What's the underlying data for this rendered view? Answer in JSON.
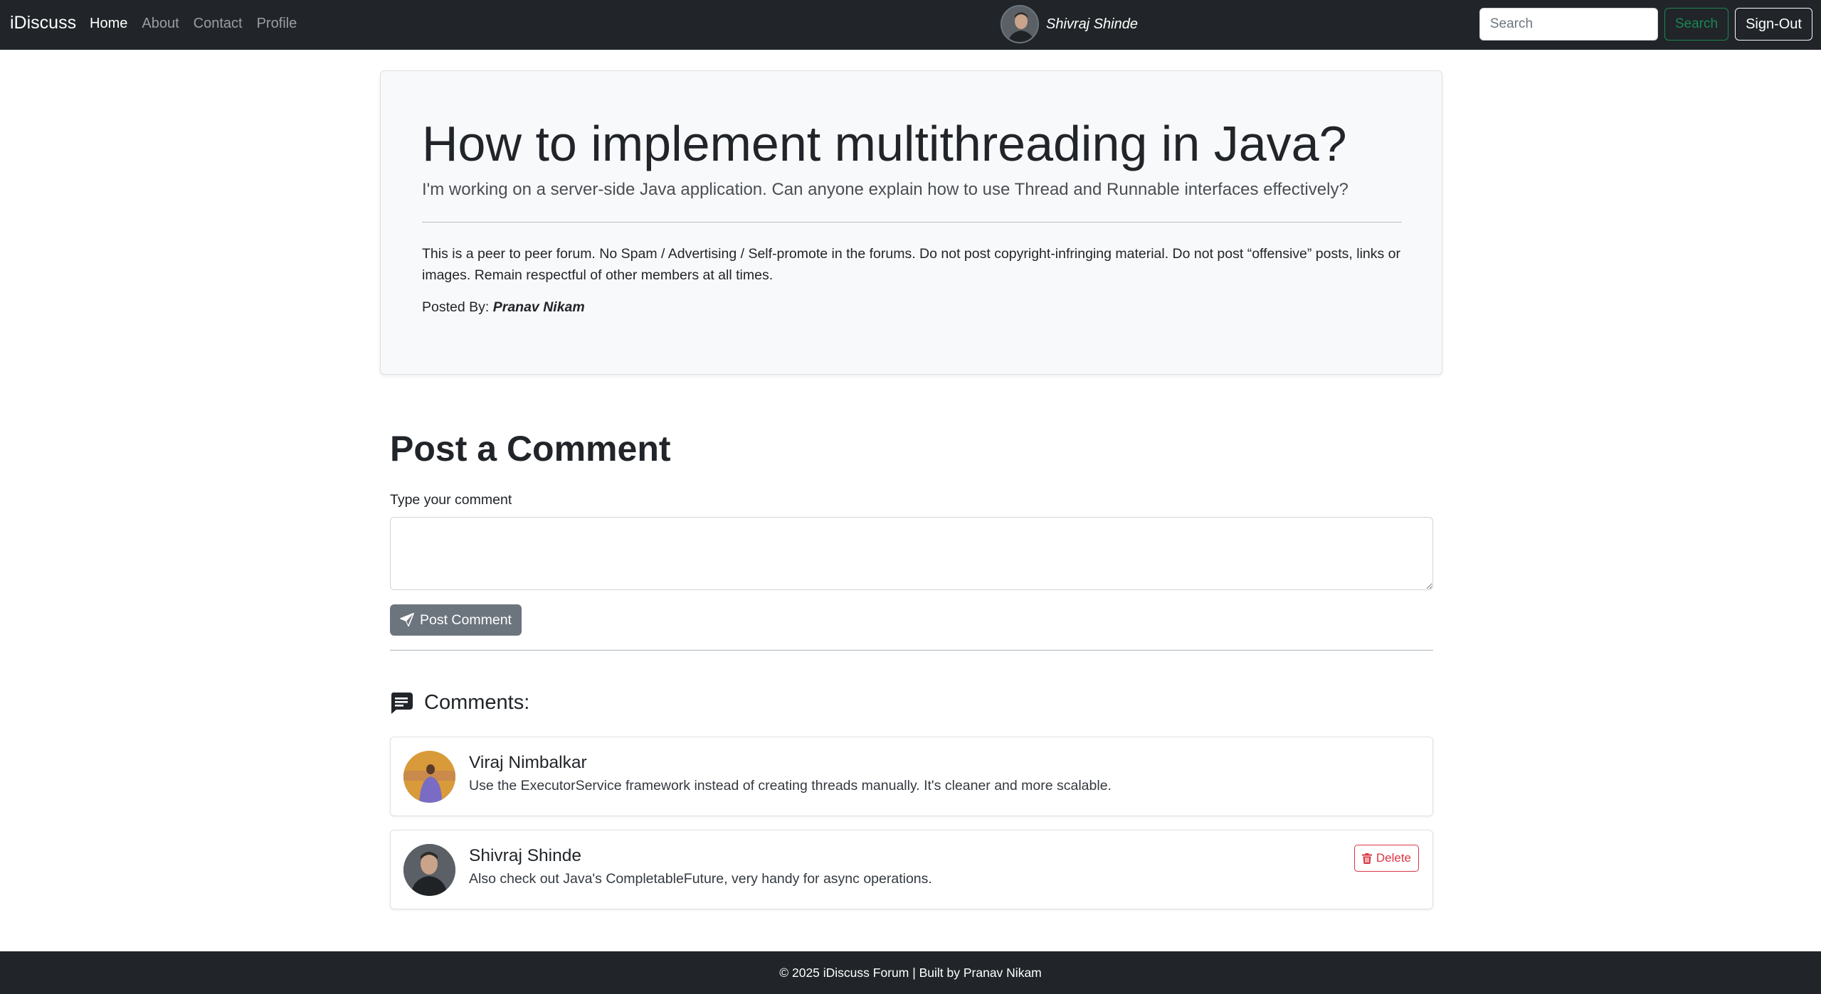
{
  "navbar": {
    "brand": "iDiscuss",
    "links": [
      {
        "label": "Home",
        "active": true
      },
      {
        "label": "About",
        "active": false
      },
      {
        "label": "Contact",
        "active": false
      },
      {
        "label": "Profile",
        "active": false
      }
    ],
    "user_name": "Shivraj Shinde",
    "search_placeholder": "Search",
    "search_value": "",
    "search_button": "Search",
    "signout_button": "Sign-Out",
    "search_button_color": "#198754"
  },
  "question": {
    "title": "How to implement multithreading in Java?",
    "description": "I'm working on a server-side Java application. Can anyone explain how to use Thread and Runnable interfaces effectively?",
    "rules": "This is a peer to peer forum. No Spam / Advertising / Self-promote in the forums. Do not post copyright-infringing material. Do not post “offensive” posts, links or images. Remain respectful of other members at all times.",
    "posted_by_label": "Posted By:",
    "posted_by_name": "Pranav Nikam"
  },
  "post_comment": {
    "heading": "Post a Comment",
    "label": "Type your comment",
    "textarea_value": "",
    "button_label": "Post Comment",
    "button_icon": "send-icon"
  },
  "comments_section": {
    "heading": "Comments:",
    "heading_icon": "comment-icon",
    "items": [
      {
        "author": "Viraj Nimbalkar",
        "text": "Use the ExecutorService framework instead of creating threads manually. It's cleaner and more scalable.",
        "can_delete": false
      },
      {
        "author": "Shivraj Shinde",
        "text": "Also check out Java's CompletableFuture, very handy for async operations.",
        "can_delete": true,
        "delete_label": "Delete",
        "delete_icon": "trash-icon",
        "delete_color": "#dc3545"
      }
    ]
  },
  "footer": {
    "text": "© 2025 iDiscuss Forum | Built by Pranav Nikam"
  }
}
